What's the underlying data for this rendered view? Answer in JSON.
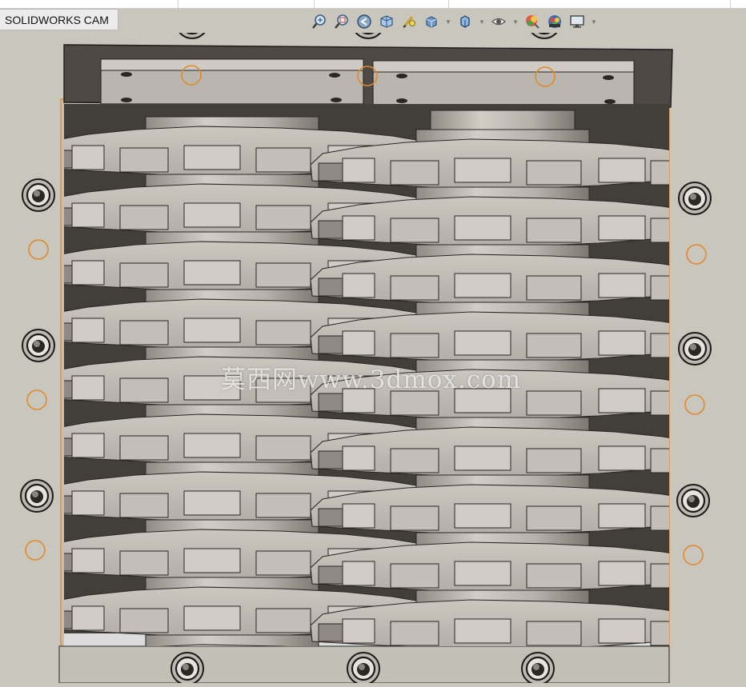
{
  "cam_tab": {
    "label": "SOLIDWORKS CAM"
  },
  "toolbar": {
    "tools": [
      {
        "name": "zoom-to-fit-icon",
        "dropdown": false
      },
      {
        "name": "zoom-to-area-icon",
        "dropdown": false
      },
      {
        "name": "previous-view-icon",
        "dropdown": false
      },
      {
        "name": "section-view-icon",
        "dropdown": false
      },
      {
        "name": "dynamic-annotation-icon",
        "dropdown": false
      },
      {
        "name": "view-orientation-icon",
        "dropdown": true
      },
      {
        "name": "display-style-icon",
        "dropdown": true
      },
      {
        "name": "hide-show-items-icon",
        "dropdown": true
      },
      {
        "name": "edit-appearance-icon",
        "dropdown": false
      },
      {
        "name": "scenes-icon",
        "dropdown": false
      },
      {
        "name": "view-settings-icon",
        "dropdown": true
      }
    ]
  },
  "watermark": {
    "text": "莫西网www.3dmox.com"
  },
  "colors": {
    "background": "#c9c6be",
    "frame_dark": "#4e4945",
    "blade_light": "#c6c2bb",
    "blade_mid": "#a9a49d",
    "outline": "#2a2725",
    "selection_orange": "#e08a2c"
  }
}
